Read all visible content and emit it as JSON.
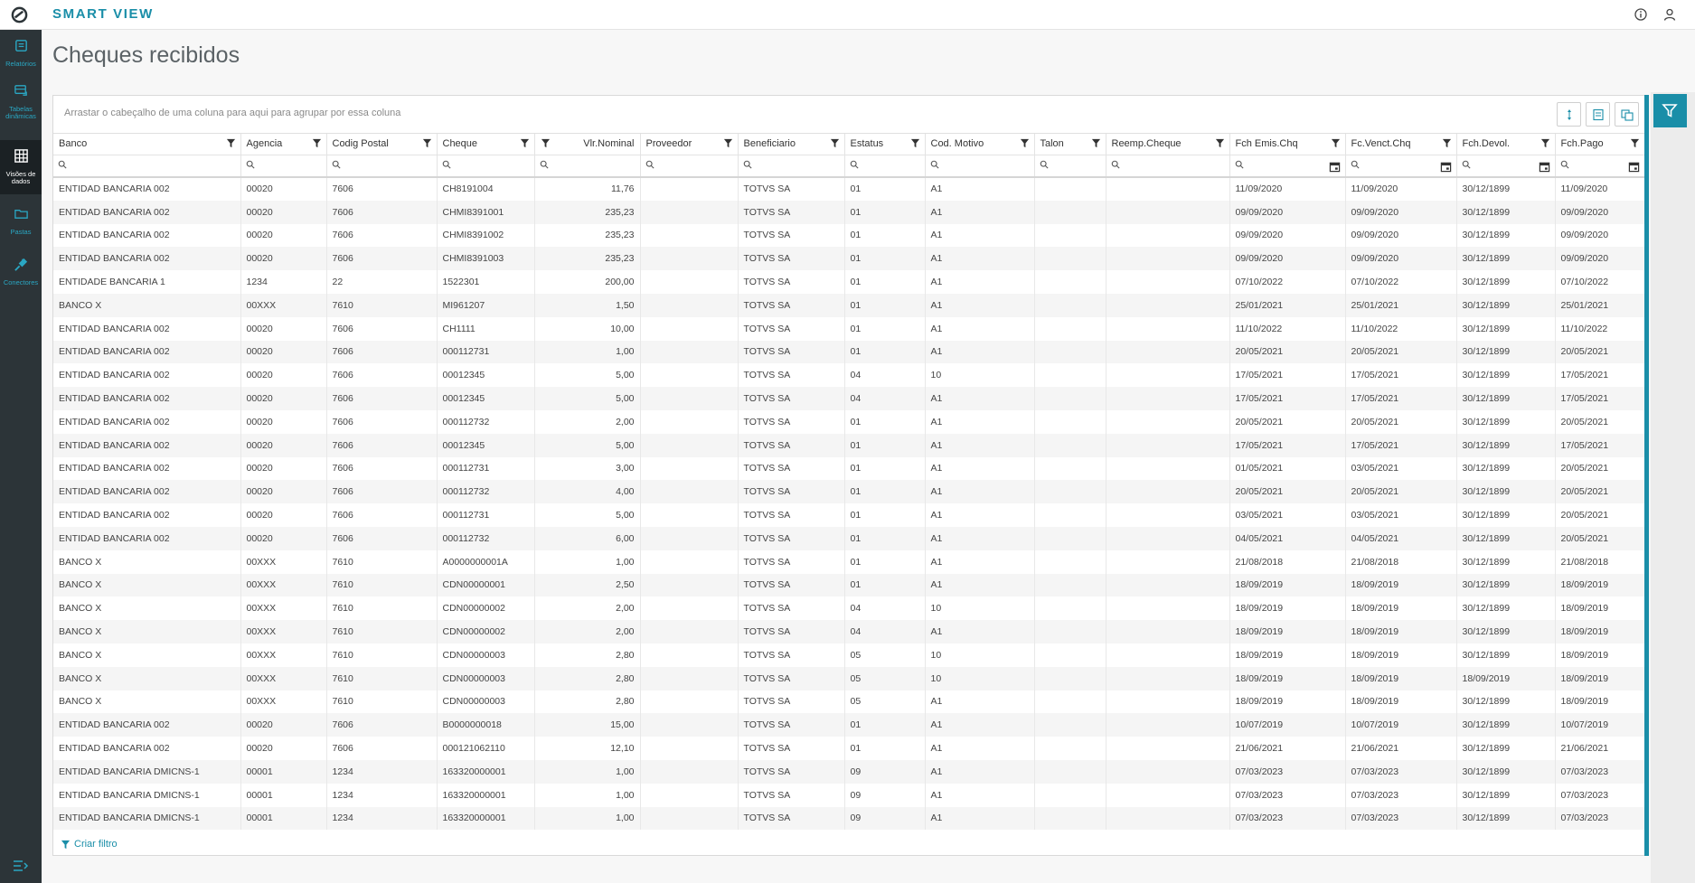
{
  "app": {
    "title": "SMART VIEW"
  },
  "sidebar": {
    "items": [
      {
        "label": "Relatórios",
        "icon": "report-icon"
      },
      {
        "label": "Tabelas dinâmicas",
        "icon": "pivot-table-icon"
      },
      {
        "label": "Visões de dados",
        "icon": "data-view-icon",
        "active": true
      },
      {
        "label": "Pastas",
        "icon": "folder-icon"
      },
      {
        "label": "Conectores",
        "icon": "plug-icon"
      }
    ]
  },
  "page": {
    "title": "Cheques recibidos"
  },
  "grid": {
    "group_hint": "Arrastar o cabeçalho de uma coluna para aqui para agrupar por essa coluna",
    "create_filter": "Criar filtro",
    "columns": [
      "Banco",
      "Agencia",
      "Codig Postal",
      "Cheque",
      "Vlr.Nominal",
      "Proveedor",
      "Beneficiario",
      "Estatus",
      "Cod. Motivo",
      "Talon",
      "Reemp.Cheque",
      "Fch Emis.Chq",
      "Fc.Venct.Chq",
      "Fch.Devol.",
      "Fch.Pago"
    ],
    "rows": [
      [
        "ENTIDAD BANCARIA 002",
        "00020",
        "7606",
        "CH8191004",
        "11,76",
        "",
        "TOTVS SA",
        "01",
        "A1",
        "",
        "",
        "11/09/2020",
        "11/09/2020",
        "30/12/1899",
        "11/09/2020"
      ],
      [
        "ENTIDAD BANCARIA 002",
        "00020",
        "7606",
        "CHMI8391001",
        "235,23",
        "",
        "TOTVS SA",
        "01",
        "A1",
        "",
        "",
        "09/09/2020",
        "09/09/2020",
        "30/12/1899",
        "09/09/2020"
      ],
      [
        "ENTIDAD BANCARIA 002",
        "00020",
        "7606",
        "CHMI8391002",
        "235,23",
        "",
        "TOTVS SA",
        "01",
        "A1",
        "",
        "",
        "09/09/2020",
        "09/09/2020",
        "30/12/1899",
        "09/09/2020"
      ],
      [
        "ENTIDAD BANCARIA 002",
        "00020",
        "7606",
        "CHMI8391003",
        "235,23",
        "",
        "TOTVS SA",
        "01",
        "A1",
        "",
        "",
        "09/09/2020",
        "09/09/2020",
        "30/12/1899",
        "09/09/2020"
      ],
      [
        "ENTIDADE BANCARIA 1",
        "1234",
        "22",
        "1522301",
        "200,00",
        "",
        "TOTVS SA",
        "01",
        "A1",
        "",
        "",
        "07/10/2022",
        "07/10/2022",
        "30/12/1899",
        "07/10/2022"
      ],
      [
        "BANCO X",
        "00XXX",
        "7610",
        "MI961207",
        "1,50",
        "",
        "TOTVS SA",
        "01",
        "A1",
        "",
        "",
        "25/01/2021",
        "25/01/2021",
        "30/12/1899",
        "25/01/2021"
      ],
      [
        "ENTIDAD BANCARIA 002",
        "00020",
        "7606",
        "CH1111",
        "10,00",
        "",
        "TOTVS SA",
        "01",
        "A1",
        "",
        "",
        "11/10/2022",
        "11/10/2022",
        "30/12/1899",
        "11/10/2022"
      ],
      [
        "ENTIDAD BANCARIA 002",
        "00020",
        "7606",
        "000112731",
        "1,00",
        "",
        "TOTVS SA",
        "01",
        "A1",
        "",
        "",
        "20/05/2021",
        "20/05/2021",
        "30/12/1899",
        "20/05/2021"
      ],
      [
        "ENTIDAD BANCARIA 002",
        "00020",
        "7606",
        "00012345",
        "5,00",
        "",
        "TOTVS SA",
        "04",
        "10",
        "",
        "",
        "17/05/2021",
        "17/05/2021",
        "30/12/1899",
        "17/05/2021"
      ],
      [
        "ENTIDAD BANCARIA 002",
        "00020",
        "7606",
        "00012345",
        "5,00",
        "",
        "TOTVS SA",
        "04",
        "A1",
        "",
        "",
        "17/05/2021",
        "17/05/2021",
        "30/12/1899",
        "17/05/2021"
      ],
      [
        "ENTIDAD BANCARIA 002",
        "00020",
        "7606",
        "000112732",
        "2,00",
        "",
        "TOTVS SA",
        "01",
        "A1",
        "",
        "",
        "20/05/2021",
        "20/05/2021",
        "30/12/1899",
        "20/05/2021"
      ],
      [
        "ENTIDAD BANCARIA 002",
        "00020",
        "7606",
        "00012345",
        "5,00",
        "",
        "TOTVS SA",
        "01",
        "A1",
        "",
        "",
        "17/05/2021",
        "17/05/2021",
        "30/12/1899",
        "17/05/2021"
      ],
      [
        "ENTIDAD BANCARIA 002",
        "00020",
        "7606",
        "000112731",
        "3,00",
        "",
        "TOTVS SA",
        "01",
        "A1",
        "",
        "",
        "01/05/2021",
        "03/05/2021",
        "30/12/1899",
        "20/05/2021"
      ],
      [
        "ENTIDAD BANCARIA 002",
        "00020",
        "7606",
        "000112732",
        "4,00",
        "",
        "TOTVS SA",
        "01",
        "A1",
        "",
        "",
        "20/05/2021",
        "20/05/2021",
        "30/12/1899",
        "20/05/2021"
      ],
      [
        "ENTIDAD BANCARIA 002",
        "00020",
        "7606",
        "000112731",
        "5,00",
        "",
        "TOTVS SA",
        "01",
        "A1",
        "",
        "",
        "03/05/2021",
        "03/05/2021",
        "30/12/1899",
        "20/05/2021"
      ],
      [
        "ENTIDAD BANCARIA 002",
        "00020",
        "7606",
        "000112732",
        "6,00",
        "",
        "TOTVS SA",
        "01",
        "A1",
        "",
        "",
        "04/05/2021",
        "04/05/2021",
        "30/12/1899",
        "20/05/2021"
      ],
      [
        "BANCO X",
        "00XXX",
        "7610",
        "A0000000001A",
        "1,00",
        "",
        "TOTVS SA",
        "01",
        "A1",
        "",
        "",
        "21/08/2018",
        "21/08/2018",
        "30/12/1899",
        "21/08/2018"
      ],
      [
        "BANCO X",
        "00XXX",
        "7610",
        "CDN00000001",
        "2,50",
        "",
        "TOTVS SA",
        "01",
        "A1",
        "",
        "",
        "18/09/2019",
        "18/09/2019",
        "30/12/1899",
        "18/09/2019"
      ],
      [
        "BANCO X",
        "00XXX",
        "7610",
        "CDN00000002",
        "2,00",
        "",
        "TOTVS SA",
        "04",
        "10",
        "",
        "",
        "18/09/2019",
        "18/09/2019",
        "30/12/1899",
        "18/09/2019"
      ],
      [
        "BANCO X",
        "00XXX",
        "7610",
        "CDN00000002",
        "2,00",
        "",
        "TOTVS SA",
        "04",
        "A1",
        "",
        "",
        "18/09/2019",
        "18/09/2019",
        "30/12/1899",
        "18/09/2019"
      ],
      [
        "BANCO X",
        "00XXX",
        "7610",
        "CDN00000003",
        "2,80",
        "",
        "TOTVS SA",
        "05",
        "10",
        "",
        "",
        "18/09/2019",
        "18/09/2019",
        "30/12/1899",
        "18/09/2019"
      ],
      [
        "BANCO X",
        "00XXX",
        "7610",
        "CDN00000003",
        "2,80",
        "",
        "TOTVS SA",
        "05",
        "10",
        "",
        "",
        "18/09/2019",
        "18/09/2019",
        "18/09/2019",
        "18/09/2019"
      ],
      [
        "BANCO X",
        "00XXX",
        "7610",
        "CDN00000003",
        "2,80",
        "",
        "TOTVS SA",
        "05",
        "A1",
        "",
        "",
        "18/09/2019",
        "18/09/2019",
        "30/12/1899",
        "18/09/2019"
      ],
      [
        "ENTIDAD BANCARIA 002",
        "00020",
        "7606",
        "B0000000018",
        "15,00",
        "",
        "TOTVS SA",
        "01",
        "A1",
        "",
        "",
        "10/07/2019",
        "10/07/2019",
        "30/12/1899",
        "10/07/2019"
      ],
      [
        "ENTIDAD BANCARIA 002",
        "00020",
        "7606",
        "000121062110",
        "12,10",
        "",
        "TOTVS SA",
        "01",
        "A1",
        "",
        "",
        "21/06/2021",
        "21/06/2021",
        "30/12/1899",
        "21/06/2021"
      ],
      [
        "ENTIDAD BANCARIA DMICNS-1",
        "00001",
        "1234",
        "163320000001",
        "1,00",
        "",
        "TOTVS SA",
        "09",
        "A1",
        "",
        "",
        "07/03/2023",
        "07/03/2023",
        "30/12/1899",
        "07/03/2023"
      ],
      [
        "ENTIDAD BANCARIA DMICNS-1",
        "00001",
        "1234",
        "163320000001",
        "1,00",
        "",
        "TOTVS SA",
        "09",
        "A1",
        "",
        "",
        "07/03/2023",
        "07/03/2023",
        "30/12/1899",
        "07/03/2023"
      ],
      [
        "ENTIDAD BANCARIA DMICNS-1",
        "00001",
        "1234",
        "163320000001",
        "1,00",
        "",
        "TOTVS SA",
        "09",
        "A1",
        "",
        "",
        "07/03/2023",
        "07/03/2023",
        "30/12/1899",
        "07/03/2023"
      ]
    ]
  },
  "colors": {
    "accent": "#1a8ea8",
    "sidebar": "#2c3438"
  }
}
